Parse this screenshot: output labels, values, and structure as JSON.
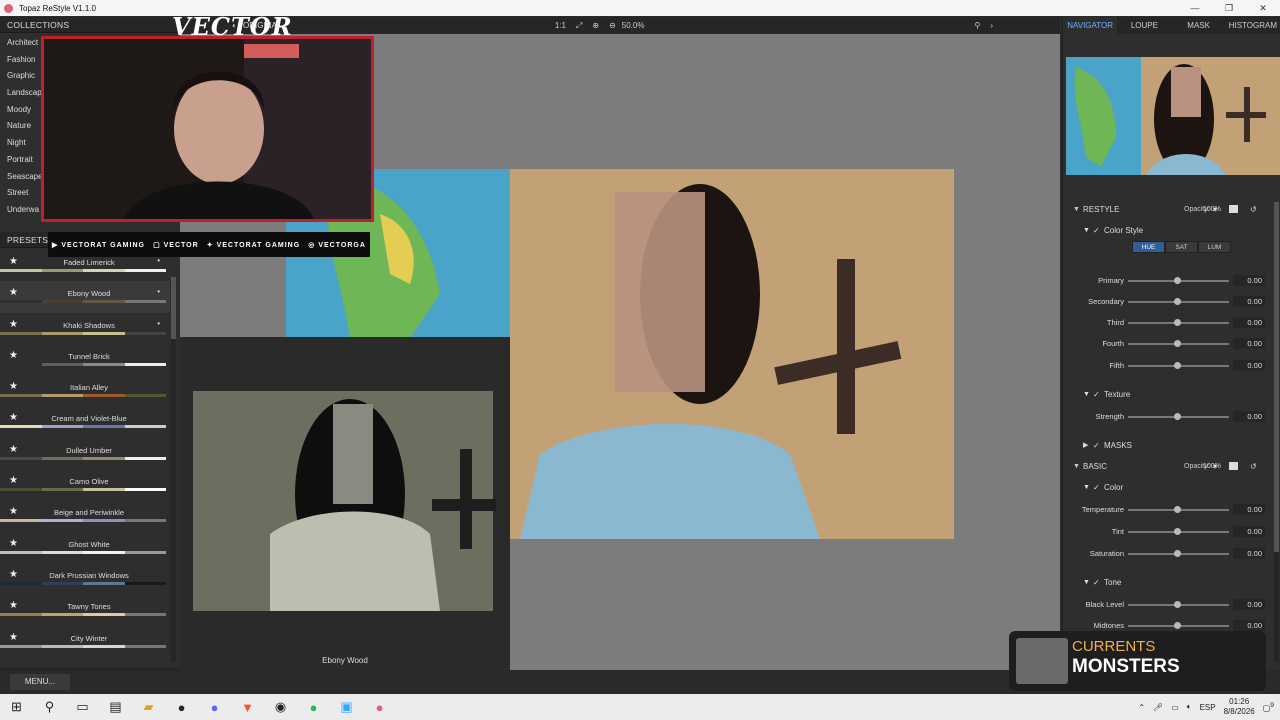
{
  "window": {
    "title": "Topaz ReStyle V1.1.0",
    "controls": [
      "—",
      "❐",
      "✕"
    ]
  },
  "left": {
    "collections_header": "COLLECTIONS",
    "collections": [
      "Architect",
      "Fashion",
      "Graphic",
      "Landscap",
      "Moody",
      "Nature",
      "Night",
      "Portrait",
      "Seascape",
      "Street",
      "Underwa"
    ],
    "presets_header": "PRESETS",
    "presets": [
      {
        "name": "Faded Limerick",
        "colors": [
          "#c7c3a0",
          "#9a9a6a",
          "#d6d3b2",
          "#eee"
        ]
      },
      {
        "name": "Ebony Wood",
        "colors": [
          "#2d2d2d",
          "#4b4033",
          "#665646",
          "#777"
        ]
      },
      {
        "name": "Khaki Shadows",
        "colors": [
          "#77704f",
          "#a8996b",
          "#c8be8f",
          "#444"
        ]
      },
      {
        "name": "Tunnel Brick",
        "colors": [
          "#2c2c2c",
          "#5e5e5e",
          "#8a8a8a",
          "#eee"
        ]
      },
      {
        "name": "Italian Alley",
        "colors": [
          "#7d6c4d",
          "#b29b6e",
          "#9a5a2e",
          "#553"
        ]
      },
      {
        "name": "Cream and Violet-Blue",
        "colors": [
          "#e7d9b0",
          "#9aa4c8",
          "#6a76a8",
          "#ccc"
        ]
      },
      {
        "name": "Dulled Umber",
        "colors": [
          "#50463c",
          "#786a5b",
          "#988975",
          "#eee"
        ]
      },
      {
        "name": "Camo Olive",
        "colors": [
          "#4c4c34",
          "#6a6a46",
          "#c8c29a",
          "#fff"
        ]
      },
      {
        "name": "Beige and Periwinkle",
        "colors": [
          "#c8b894",
          "#aab0d8",
          "#8890c4",
          "#777"
        ]
      },
      {
        "name": "Ghost White",
        "colors": [
          "#bdbdbd",
          "#dcdcdc",
          "#f2f2f2",
          "#999"
        ]
      },
      {
        "name": "Dark Prussian Windows",
        "colors": [
          "#1c2a3a",
          "#2c4058",
          "#5a7898",
          "#1a1a1a"
        ]
      },
      {
        "name": "Tawny Tones",
        "colors": [
          "#9c7a4a",
          "#c4a06c",
          "#e2c89a",
          "#777"
        ]
      },
      {
        "name": "City Winter",
        "colors": [
          "#8f9aa6",
          "#b3bcc6",
          "#d0d6dc",
          "#777"
        ]
      }
    ],
    "menu_label": "MENU..."
  },
  "toolbar": {
    "original_label": "ORIGINAL",
    "ratio": "1:1",
    "zoom": "50.0%"
  },
  "canvas": {
    "compare_label": "Ebony Wood"
  },
  "right": {
    "tabs": [
      "NAVIGATOR",
      "LOUPE",
      "MASK",
      "HISTOGRAM"
    ],
    "restyle": {
      "title": "RESTYLE",
      "opacity_label": "Opacity:",
      "opacity": "100%",
      "color_style": "Color Style",
      "modes": [
        "HUE",
        "SAT",
        "LUM"
      ],
      "sliders": [
        {
          "label": "Primary",
          "value": "0.00"
        },
        {
          "label": "Secondary",
          "value": "0.00"
        },
        {
          "label": "Third",
          "value": "0.00"
        },
        {
          "label": "Fourth",
          "value": "0.00"
        },
        {
          "label": "Fifth",
          "value": "0.00"
        }
      ],
      "texture": "Texture",
      "strength": {
        "label": "Strength",
        "value": "0.00"
      },
      "masks": "MASKS"
    },
    "basic": {
      "title": "BASIC",
      "opacity_label": "Opacity:",
      "opacity": "100%",
      "color": "Color",
      "color_sliders": [
        {
          "label": "Temperature",
          "value": "0.00"
        },
        {
          "label": "Tint",
          "value": "0.00"
        },
        {
          "label": "Saturation",
          "value": "0.00"
        }
      ],
      "tone": "Tone",
      "tone_sliders": [
        {
          "label": "Black Level",
          "value": "0.00"
        },
        {
          "label": "Midtones",
          "value": "0.00"
        }
      ]
    }
  },
  "overlay": {
    "logo": "VECTOR",
    "socials": [
      "VECTORAT GAMING",
      "VECTOR",
      "VECTORAT GAMING",
      "VECTORGA"
    ],
    "now_playing_line1": "CURRENTS",
    "now_playing_line2": "MONSTERS"
  },
  "taskbar": {
    "time": "01:26",
    "date": "8/8/2026",
    "lang": "ESP",
    "notif": "9"
  }
}
